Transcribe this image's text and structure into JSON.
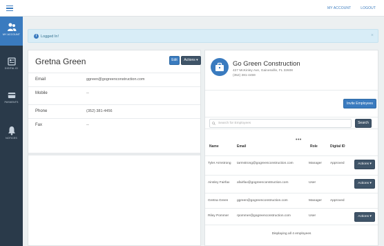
{
  "topbar": {
    "my_account": "MY ACCOUNT",
    "logout": "LOGOUT"
  },
  "sidebar": {
    "items": [
      {
        "label": "MY ACCOUNT",
        "icon": "users-icon",
        "active": true
      },
      {
        "label": "DIGITAL ID",
        "icon": "id-card-icon",
        "active": false
      },
      {
        "label": "PAYMENTS",
        "icon": "card-icon",
        "active": false
      },
      {
        "label": "NOTICES",
        "icon": "bell-icon",
        "active": false
      }
    ]
  },
  "alert": {
    "message": "Logged In!",
    "close": "×"
  },
  "contact": {
    "name": "Gretna Green",
    "edit_label": "Edit",
    "actions_label": "Actions ▾",
    "fields": [
      {
        "key": "Email",
        "value": "ggreen@gogreenconstruction.com"
      },
      {
        "key": "Mobile",
        "value": "--"
      },
      {
        "key": "Phone",
        "value": "(352) 381-4456"
      },
      {
        "key": "Fax",
        "value": "--"
      }
    ]
  },
  "company": {
    "name": "Go Green Construction",
    "address": "427 McKinley Ave, Gainesville, FL 32608",
    "phone": "(352) 381-4459",
    "invite_label": "Invite Employees",
    "search_placeholder": "Search for Employees",
    "search_button": "Search",
    "more_dots": "•••",
    "table": {
      "headers": [
        "Name",
        "Email",
        "Role",
        "Digital ID"
      ],
      "rows": [
        {
          "name": "Tyler Armstrong",
          "email": "tarmstrong@gogreenconstruction.com",
          "role": "Manager",
          "digital_id": "Approved",
          "actions": "Actions ▾"
        },
        {
          "name": "Ainsley Fairfax",
          "email": "afairfax@gogreenconstruction.com",
          "role": "User",
          "digital_id": "",
          "actions": "Actions ▾"
        },
        {
          "name": "Gretna Green",
          "email": "ggreen@gogreenconstruction.com",
          "role": "Manager",
          "digital_id": "Approved",
          "actions": ""
        },
        {
          "name": "Riley Pommer",
          "email": "rpommer@gogreenconstruction.com",
          "role": "User",
          "digital_id": "",
          "actions": "Actions ▾"
        }
      ]
    },
    "footer_note": "Displaying all 4 employees"
  }
}
